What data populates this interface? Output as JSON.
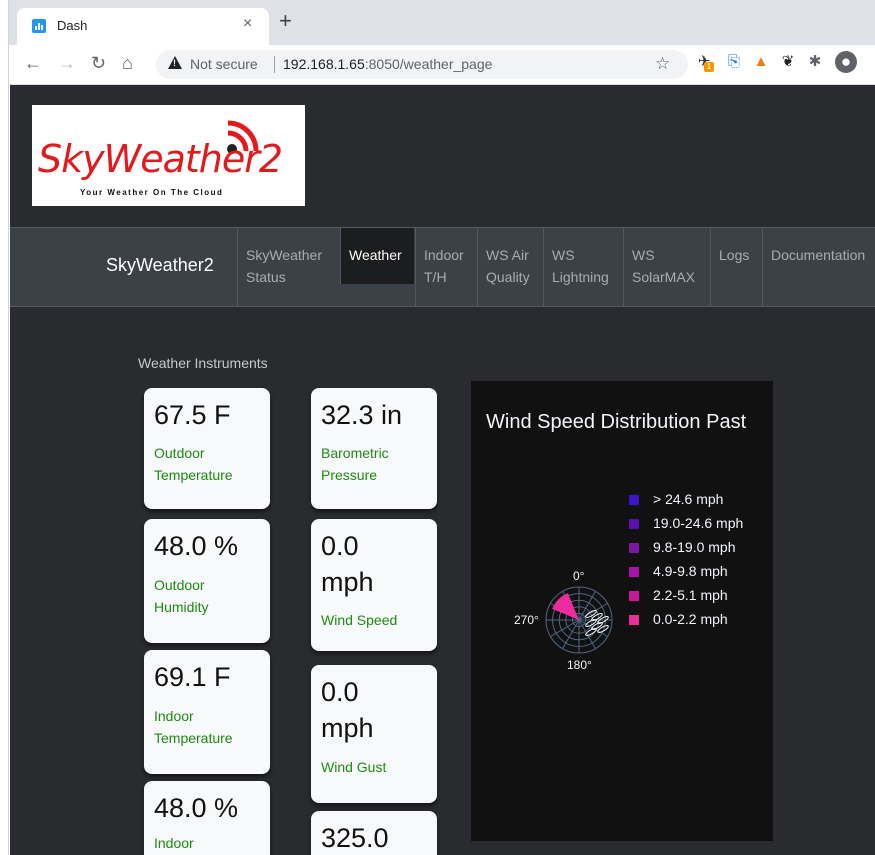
{
  "browser": {
    "tab_title": "Dash",
    "tab_close": "×",
    "new_tab": "+",
    "not_secure": "Not secure",
    "url_host": "192.168.1.65",
    "url_port_path": ":8050/weather_page",
    "ext_badge": "1"
  },
  "logo": {
    "text": "SkyWeather2",
    "tagline": "Your Weather On The Cloud"
  },
  "navbar": {
    "brand": "SkyWeather2",
    "items": [
      {
        "label": "SkyWeather Status"
      },
      {
        "label": "Weather",
        "active": true
      },
      {
        "label": "Indoor T/H"
      },
      {
        "label": "WS Air Quality"
      },
      {
        "label": "WS Lightning"
      },
      {
        "label": "WS SolarMAX"
      },
      {
        "label": "Logs"
      },
      {
        "label": "Documentation"
      }
    ]
  },
  "section_title": "Weather Instruments",
  "cards": [
    {
      "value": "67.5 F",
      "label": "Outdoor Temperature"
    },
    {
      "value": "48.0 %",
      "label": "Outdoor Humidity"
    },
    {
      "value": "69.1 F",
      "label": "Indoor Temperature"
    },
    {
      "value": "48.0 %",
      "label": "Indoor"
    },
    {
      "value": "32.3 in",
      "label": "Barometric Pressure"
    },
    {
      "value": "0.0 mph",
      "label": "Wind Speed"
    },
    {
      "value": "0.0 mph",
      "label": "Wind Gust"
    },
    {
      "value": "325.0",
      "label": ""
    }
  ],
  "chart_data": {
    "type": "barpolar",
    "title": "Wind Speed Distribution Past",
    "angular_ticks": [
      "0°",
      "270°",
      "180°"
    ],
    "series": [
      {
        "name": "> 24.6  mph",
        "color": "#3b16c7"
      },
      {
        "name": "19.0-24.6  mph",
        "color": "#5c0fb0"
      },
      {
        "name": "9.8-19.0  mph",
        "color": "#7c17a5"
      },
      {
        "name": "4.9-9.8  mph",
        "color": "#a416a8"
      },
      {
        "name": "2.2-5.1  mph",
        "color": "#c9169c"
      },
      {
        "name": "0.0-2.2  mph",
        "color": "#ec2b9c"
      }
    ],
    "visible_sector": {
      "direction_deg": 315,
      "series": "0.0-2.2  mph"
    },
    "legend_position": "right",
    "background": "#111111"
  }
}
